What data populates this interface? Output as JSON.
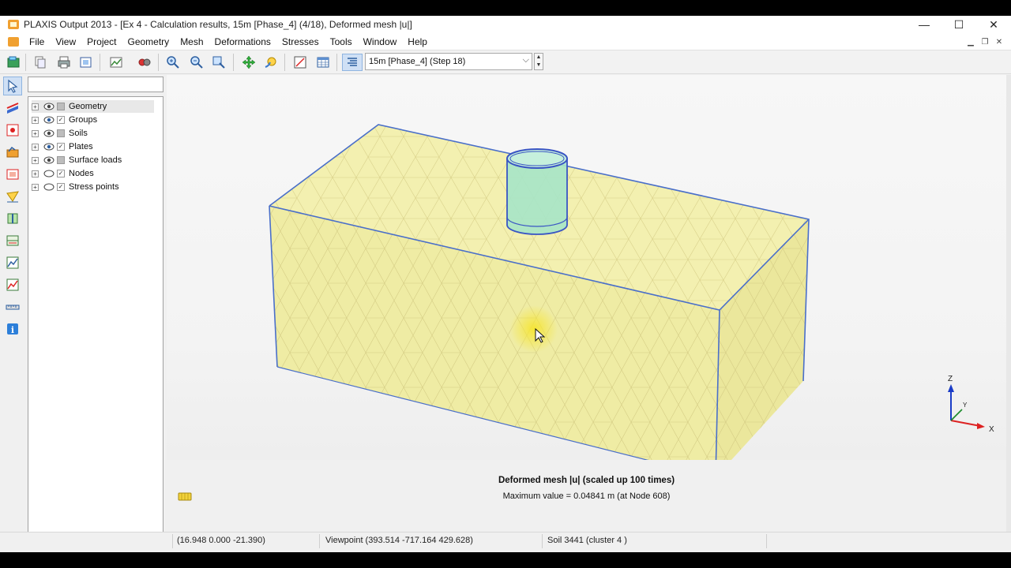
{
  "window": {
    "title": "PLAXIS Output 2013 - [Ex 4 - Calculation results, 15m [Phase_4] (4/18), Deformed mesh |u|]",
    "controls": {
      "minimize": "—",
      "maximize": "☐",
      "close": "✕"
    }
  },
  "menu": [
    "File",
    "View",
    "Project",
    "Geometry",
    "Mesh",
    "Deformations",
    "Stresses",
    "Tools",
    "Window",
    "Help"
  ],
  "toolbar": {
    "step_select": "15m [Phase_4] (Step 18)",
    "icons": [
      "open-project-icon",
      "copy-icon",
      "print-icon",
      "export-icon",
      "image-icon",
      "camera-icon",
      "zoom-in-icon",
      "zoom-out-icon",
      "zoom-fit-icon",
      "move-icon",
      "rotate-light-icon",
      "scale-icon",
      "table-icon",
      "phase-select-icon"
    ]
  },
  "left_tools": [
    "select-icon",
    "cross-section-icon",
    "node-select-icon",
    "curve-icon",
    "area-icon",
    "draw-line-icon",
    "plate-icon",
    "layer-icon",
    "chart-icon",
    "edit-chart-icon",
    "ruler-icon",
    "info-icon"
  ],
  "tree": {
    "search_value": "",
    "items": [
      {
        "label": "Geometry",
        "checked": false
      },
      {
        "label": "Groups",
        "checked": true
      },
      {
        "label": "Soils",
        "checked": false
      },
      {
        "label": "Plates",
        "checked": true
      },
      {
        "label": "Surface loads",
        "checked": false
      },
      {
        "label": "Nodes",
        "checked": true
      },
      {
        "label": "Stress points",
        "checked": true
      }
    ]
  },
  "viewport": {
    "caption_title": "Deformed mesh |u| (scaled up 100 times)",
    "caption_sub": "Maximum value = 0.04841 m (at Node 608)",
    "axes": {
      "z": "Z",
      "y": "Y",
      "x": "X"
    },
    "colors": {
      "soil": "#f0eda3",
      "edge": "#4a6fc9",
      "pile": "#9fe0c4",
      "mesh_line": "#cfc98a",
      "cursor_highlight": "#f6e531"
    }
  },
  "status": {
    "coords": "(16.948 0.000 -21.390)",
    "viewpoint": "Viewpoint (393.514 -717.164 429.628)",
    "soil": "Soil 3441 (cluster 4 )"
  }
}
